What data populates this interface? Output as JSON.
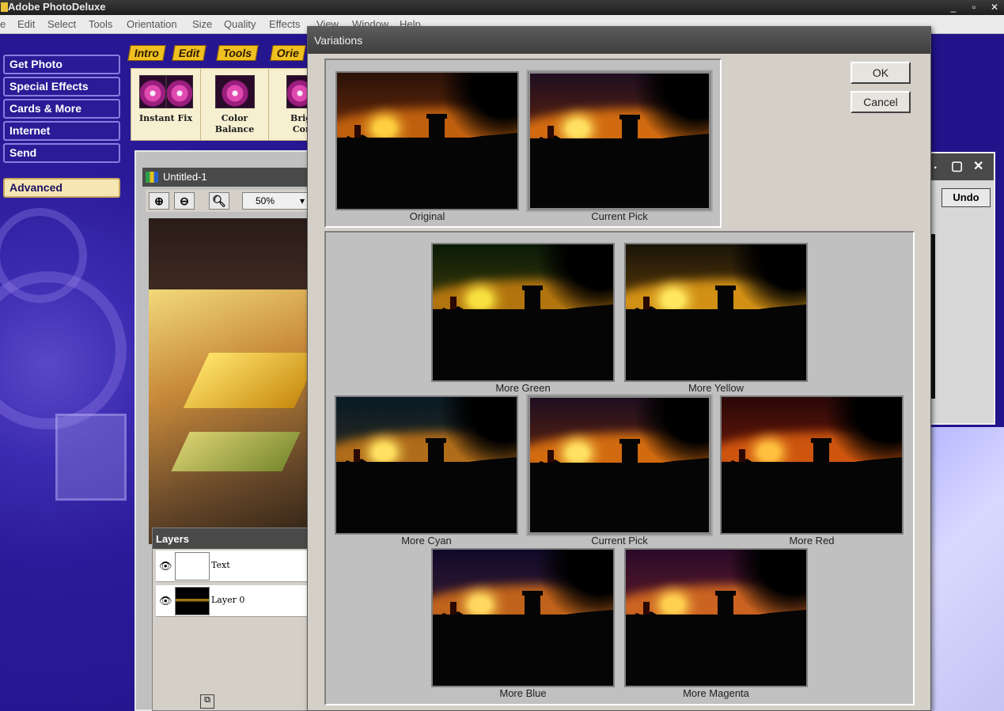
{
  "window": {
    "title": "Adobe PhotoDeluxe",
    "controls": [
      "_",
      "▫",
      "✕"
    ]
  },
  "menu": [
    "e",
    "Edit",
    "Select",
    "Tools",
    "Orientation",
    "Size",
    "Quality",
    "Effects",
    "View",
    "Window",
    "Help"
  ],
  "nav": {
    "get_photo": "Get Photo",
    "special_effects": "Special Effects",
    "cards_more": "Cards & More",
    "internet": "Internet",
    "send": "Send",
    "advanced": "Advanced"
  },
  "tabs": [
    "Intro",
    "Edit",
    "Tools",
    "Orie"
  ],
  "tools": [
    {
      "label_1": "Instant Fix",
      "label_2": ""
    },
    {
      "label_1": "Color",
      "label_2": "Balance"
    },
    {
      "label_1": "Brig",
      "label_2": "Con"
    }
  ],
  "document": {
    "title": "Untitled-1",
    "zoom": "50%"
  },
  "layers": {
    "title": "Layers",
    "rows": [
      {
        "name": "Text"
      },
      {
        "name": "Layer 0"
      }
    ]
  },
  "right_window": {
    "undo_label": "Undo"
  },
  "variations": {
    "title": "Variations",
    "ok_label": "OK",
    "cancel_label": "Cancel",
    "original": {
      "caption": "Original",
      "sky": [
        "#2a1208",
        "#6a2a0a"
      ],
      "cloud": "#d06a10",
      "sun": "#ffd040"
    },
    "current_pick_top": {
      "caption": "Current Pick",
      "sky": [
        "#1e0e20",
        "#5a2210"
      ],
      "cloud": "#e87810",
      "sun": "#ffe060"
    },
    "options": [
      {
        "caption": "More Green",
        "sky": [
          "#0a1a08",
          "#3a3a08"
        ],
        "cloud": "#c88010",
        "sun": "#f8e040"
      },
      {
        "caption": "More Yellow",
        "sky": [
          "#1a1408",
          "#5a3a08"
        ],
        "cloud": "#e8a018",
        "sun": "#ffe860"
      },
      {
        "caption": "More Cyan",
        "sky": [
          "#081a24",
          "#2a2a20"
        ],
        "cloud": "#c87818",
        "sun": "#ffe060"
      },
      {
        "caption": "Current Pick",
        "sky": [
          "#1e0e20",
          "#5a2210"
        ],
        "cloud": "#e87810",
        "sun": "#ffe060"
      },
      {
        "caption": "More Red",
        "sky": [
          "#2a0808",
          "#6a1808"
        ],
        "cloud": "#e06010",
        "sun": "#ffc040"
      },
      {
        "caption": "More Blue",
        "sky": [
          "#0e0a2a",
          "#3a1a30"
        ],
        "cloud": "#d87018",
        "sun": "#ffd860"
      },
      {
        "caption": "More Magenta",
        "sky": [
          "#2a0a28",
          "#5a1a28"
        ],
        "cloud": "#e07020",
        "sun": "#ffd050"
      }
    ]
  }
}
